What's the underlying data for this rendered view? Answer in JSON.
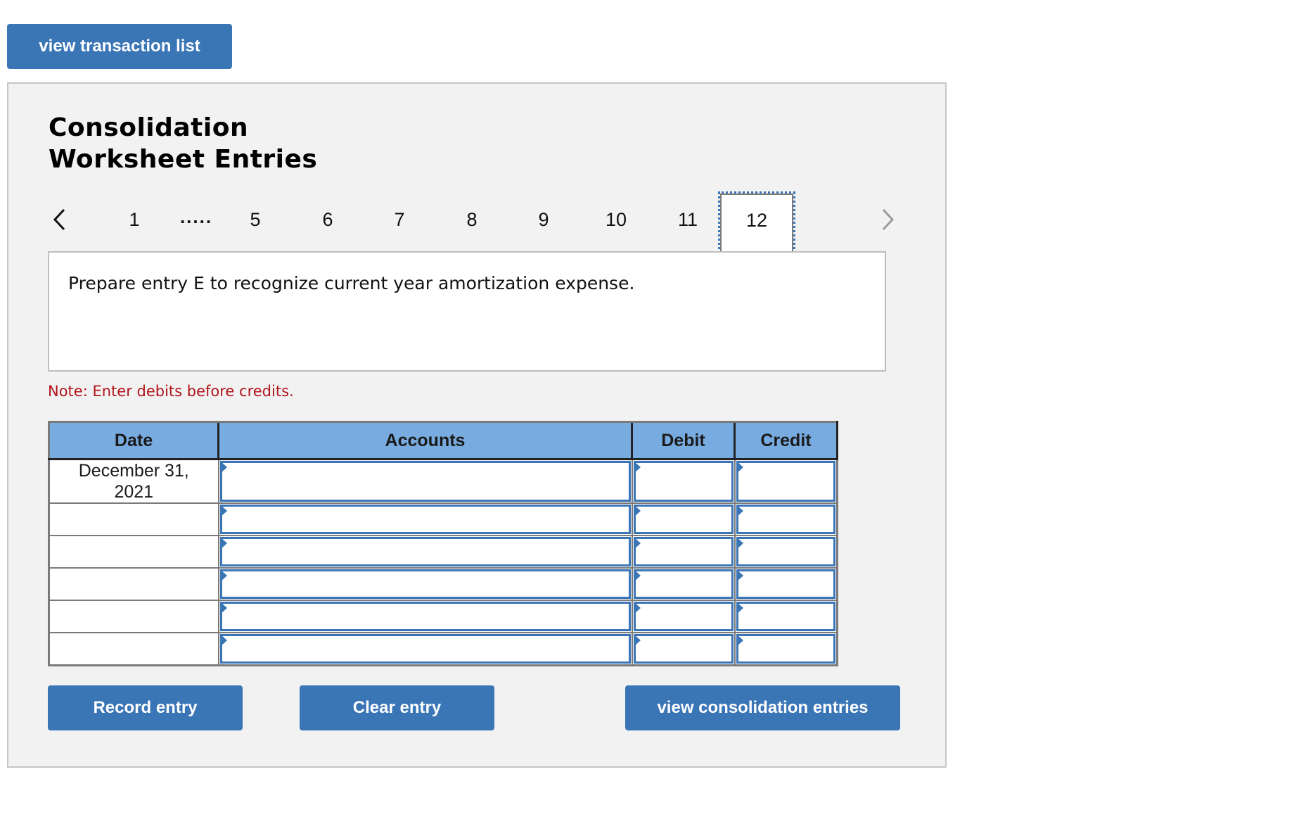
{
  "top_button": {
    "label": "view transaction list"
  },
  "panel": {
    "title_line1": "Consolidation",
    "title_line2": "Worksheet Entries",
    "pagination": {
      "prev_icon": "chevron-left-icon",
      "next_icon": "chevron-right-icon",
      "items": [
        "1",
        ".....",
        "5",
        "6",
        "7",
        "8",
        "9",
        "10",
        "11"
      ],
      "active": "12",
      "next_disabled": true
    },
    "instruction": "Prepare entry E to recognize current year amortization expense.",
    "note": "Note: Enter debits before credits.",
    "table": {
      "headers": [
        "Date",
        "Accounts",
        "Debit",
        "Credit"
      ],
      "rows": [
        {
          "date": "December 31, 2021",
          "account": "",
          "debit": "",
          "credit": ""
        },
        {
          "date": "",
          "account": "",
          "debit": "",
          "credit": ""
        },
        {
          "date": "",
          "account": "",
          "debit": "",
          "credit": ""
        },
        {
          "date": "",
          "account": "",
          "debit": "",
          "credit": ""
        },
        {
          "date": "",
          "account": "",
          "debit": "",
          "credit": ""
        },
        {
          "date": "",
          "account": "",
          "debit": "",
          "credit": ""
        }
      ]
    },
    "buttons": {
      "record": "Record entry",
      "clear": "Clear entry",
      "view_consolidation": "view consolidation entries"
    }
  },
  "colors": {
    "button_blue": "#3a75b6",
    "header_blue": "#78abe0",
    "note_red": "#b1141b",
    "panel_bg": "#f2f2f2"
  }
}
